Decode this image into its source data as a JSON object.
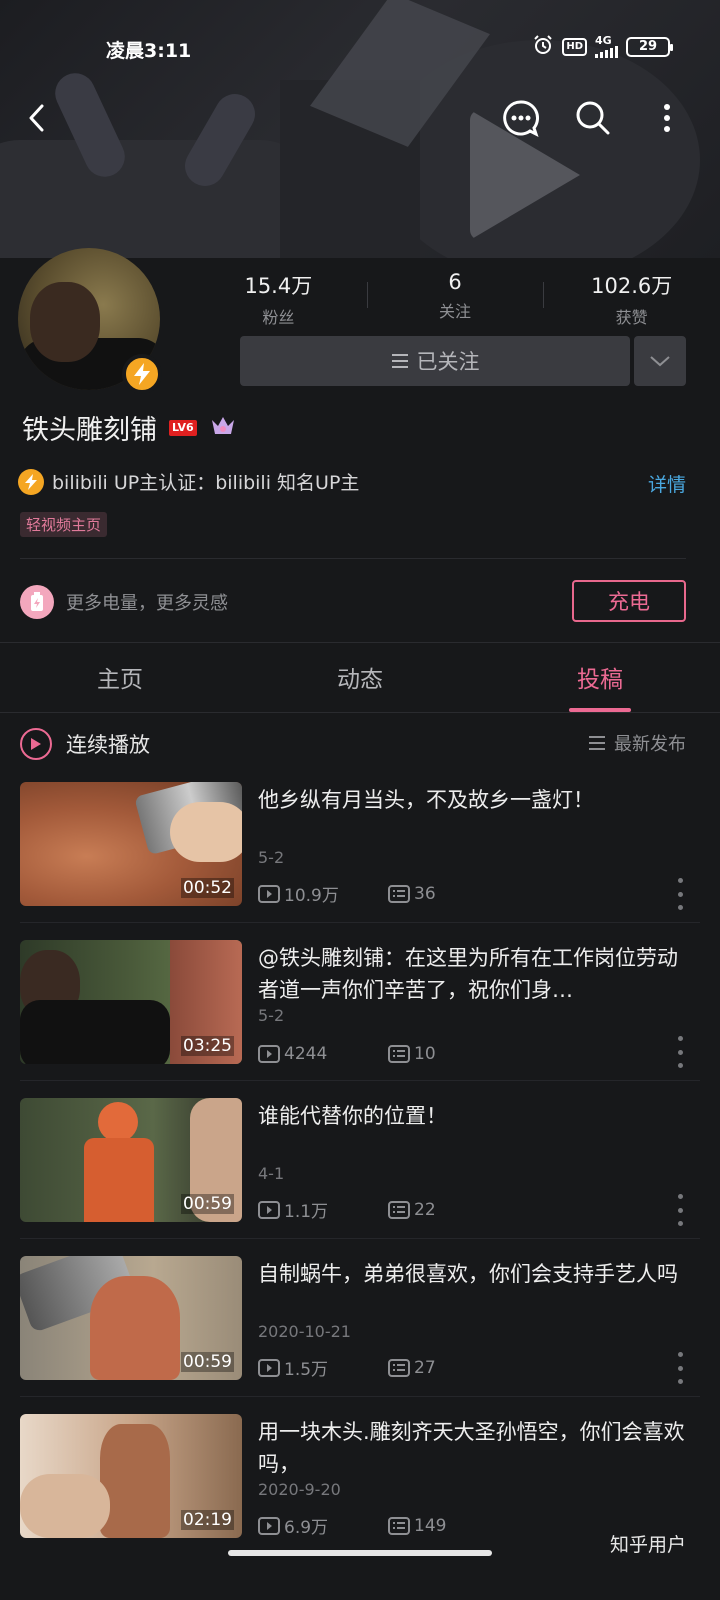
{
  "status_bar": {
    "time": "凌晨3:11",
    "hd": "HD",
    "network": "4G",
    "battery": "29"
  },
  "profile": {
    "fans_count": "15.4万",
    "fans_label": "粉丝",
    "following_count": "6",
    "following_label": "关注",
    "likes_count": "102.6万",
    "likes_label": "获赞",
    "follow_button": "已关注",
    "username": "铁头雕刻铺",
    "level_badge": "LV6",
    "verify_text": "bilibili UP主认证：bilibili 知名UP主",
    "detail_link": "详情",
    "light_video_tag": "轻视频主页"
  },
  "charge": {
    "text": "更多电量，更多灵感",
    "button": "充电"
  },
  "tabs": [
    {
      "label": "主页",
      "active": false
    },
    {
      "label": "动态",
      "active": false
    },
    {
      "label": "投稿",
      "active": true
    }
  ],
  "playlist": {
    "play_label": "连续播放",
    "sort_label": "最新发布"
  },
  "videos": [
    {
      "title": "他乡纵有月当头，不及故乡一盏灯！",
      "date": "5-2",
      "duration": "00:52",
      "views": "10.9万",
      "comments": "36"
    },
    {
      "title": "@铁头雕刻铺：在这里为所有在工作岗位劳动者道一声你们辛苦了，祝你们身…",
      "date": "5-2",
      "duration": "03:25",
      "views": "4244",
      "comments": "10"
    },
    {
      "title": "谁能代替你的位置！",
      "date": "4-1",
      "duration": "00:59",
      "views": "1.1万",
      "comments": "22"
    },
    {
      "title": "自制蜗牛，弟弟很喜欢，你们会支持手艺人吗",
      "date": "2020-10-21",
      "duration": "00:59",
      "views": "1.5万",
      "comments": "27"
    },
    {
      "title": "用一块木头.雕刻齐天大圣孙悟空，你们会喜欢吗，",
      "date": "2020-9-20",
      "duration": "02:19",
      "views": "6.9万",
      "comments": "149"
    }
  ],
  "watermark": "知乎用户",
  "colors": {
    "accent_pink": "#ec6a93",
    "link_blue": "#4aa8e0",
    "badge_gold": "#f5a623",
    "background": "#17181a"
  }
}
